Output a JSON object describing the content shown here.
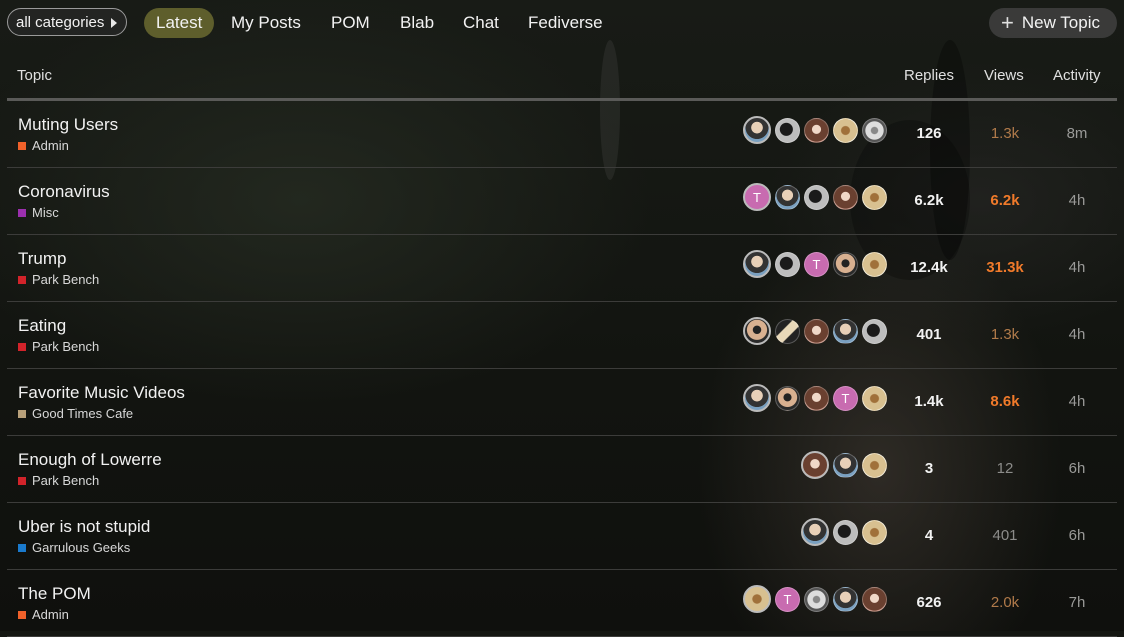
{
  "nav": {
    "category_dropdown": "all categories",
    "tabs": [
      {
        "label": "Latest",
        "active": true
      },
      {
        "label": "My Posts"
      },
      {
        "label": "POM"
      },
      {
        "label": "Blab"
      },
      {
        "label": "Chat"
      },
      {
        "label": "Fediverse"
      }
    ],
    "new_topic": "New Topic"
  },
  "table": {
    "headers": {
      "topic": "Topic",
      "replies": "Replies",
      "views": "Views",
      "activity": "Activity"
    },
    "rows": [
      {
        "title": "Muting Users",
        "category": "Admin",
        "category_color": "#f0612a",
        "avatars": [
          "face",
          "gray",
          "brown",
          "beach",
          "mono"
        ],
        "replies": "126",
        "views": "1.3k",
        "views_heat": "warm",
        "activity": "8m"
      },
      {
        "title": "Coronavirus",
        "category": "Misc",
        "category_color": "#9b2fae",
        "avatars": [
          "t",
          "face",
          "gray",
          "brown",
          "beach"
        ],
        "avatar_letter": "T",
        "replies": "6.2k",
        "views": "6.2k",
        "views_heat": "hot",
        "activity": "4h"
      },
      {
        "title": "Trump",
        "category": "Park Bench",
        "category_color": "#d2232a",
        "avatars": [
          "face",
          "gray",
          "t",
          "sun",
          "beach"
        ],
        "avatar_letter": "T",
        "replies": "12.4k",
        "views": "31.3k",
        "views_heat": "hot",
        "activity": "4h"
      },
      {
        "title": "Eating",
        "category": "Park Bench",
        "category_color": "#d2232a",
        "avatars": [
          "sun",
          "bat",
          "brown",
          "face",
          "gray"
        ],
        "replies": "401",
        "views": "1.3k",
        "views_heat": "warm",
        "activity": "4h"
      },
      {
        "title": "Favorite Music Videos",
        "category": "Good Times Cafe",
        "category_color": "#b8a07a",
        "avatars": [
          "face",
          "sun",
          "brown",
          "t",
          "beach"
        ],
        "avatar_letter": "T",
        "replies": "1.4k",
        "views": "8.6k",
        "views_heat": "hot",
        "activity": "4h"
      },
      {
        "title": "Enough of Lowerre",
        "category": "Park Bench",
        "category_color": "#d2232a",
        "avatars": [
          "brown",
          "face",
          "beach"
        ],
        "replies": "3",
        "views": "12",
        "views_heat": "normal",
        "activity": "6h"
      },
      {
        "title": "Uber is not stupid",
        "category": "Garrulous Geeks",
        "category_color": "#1a7acd",
        "avatars": [
          "face",
          "gray",
          "beach"
        ],
        "replies": "4",
        "views": "401",
        "views_heat": "normal",
        "activity": "6h"
      },
      {
        "title": "The POM",
        "category": "Admin",
        "category_color": "#f0612a",
        "avatars": [
          "beach",
          "t",
          "mono",
          "face",
          "brown"
        ],
        "avatar_letter": "T",
        "replies": "626",
        "views": "2.0k",
        "views_heat": "warm",
        "activity": "7h"
      }
    ]
  }
}
